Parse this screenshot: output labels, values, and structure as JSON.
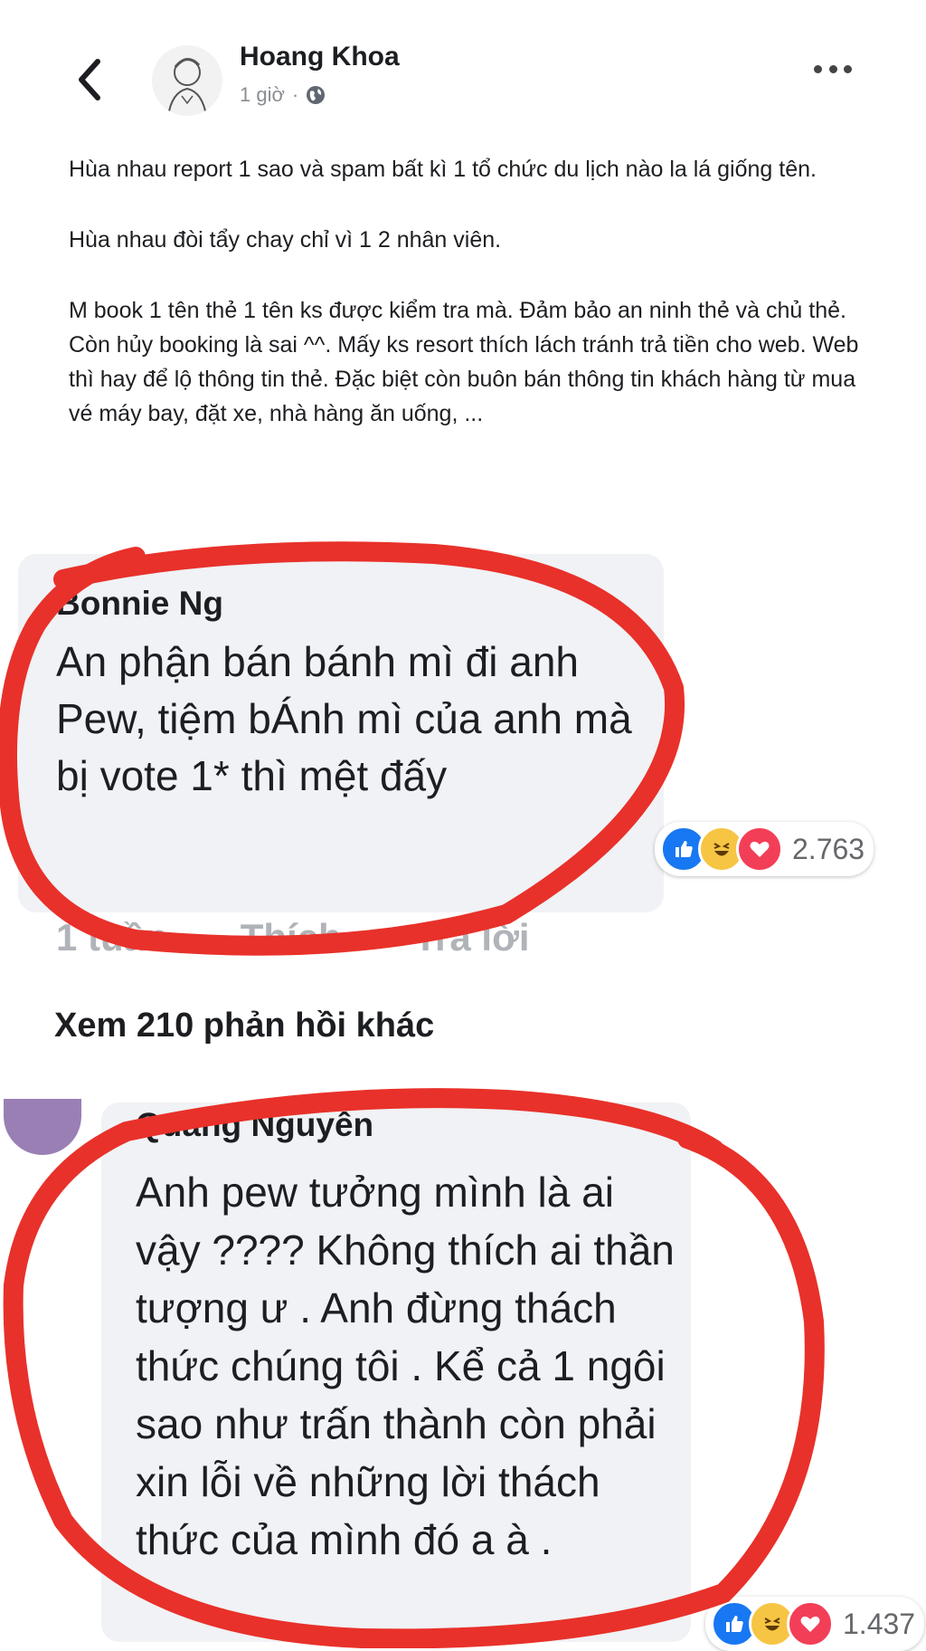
{
  "header": {
    "author": "Hoang Khoa",
    "time": "1 giờ",
    "separator": "·"
  },
  "post": {
    "paragraphs": [
      "Hùa nhau report 1 sao và spam bất kì 1 tổ chức du lịch nào la lá giống tên.",
      "Hùa nhau đòi tẩy chay chỉ vì 1 2 nhân viên.",
      "M book 1 tên thẻ 1 tên ks được kiểm tra mà. Đảm bảo an ninh thẻ và chủ thẻ. Còn hủy booking là sai ^^. Mấy ks resort thích lách tránh trả tiền cho web. Web thì hay để lộ thông tin thẻ. Đặc biệt còn buôn bán thông tin khách hàng từ mua vé máy bay, đặt xe, nhà hàng ăn uống, ..."
    ]
  },
  "comment1": {
    "author": "Bonnie Ng",
    "text": "An phận bán bánh mì đi anh Pew, tiệm bÁnh mì của anh mà bị vote 1* thì mệt đấy",
    "reaction_count": "2.763",
    "actions": [
      "1 tuần",
      "Thích",
      "Trả lời"
    ]
  },
  "more_replies": "Xem 210 phản hồi khác",
  "comment2": {
    "author": "Quang Nguyễn",
    "text": "Anh pew tưởng mình là ai vậy ???? Không thích ai thần tượng ư . Anh đừng thách thức chúng tôi . Kể cả 1 ngôi sao như trấn thành còn phải xin lỗi về những lời thách thức của mình đó a à .",
    "reaction_count": "1.437"
  },
  "colors": {
    "like": "#1877f2",
    "haha": "#f7c544",
    "love": "#f33e58",
    "circle": "#e8312a"
  },
  "icons": [
    "back-arrow-icon",
    "globe-icon",
    "more-options-icon",
    "like-icon",
    "haha-icon",
    "love-icon"
  ]
}
